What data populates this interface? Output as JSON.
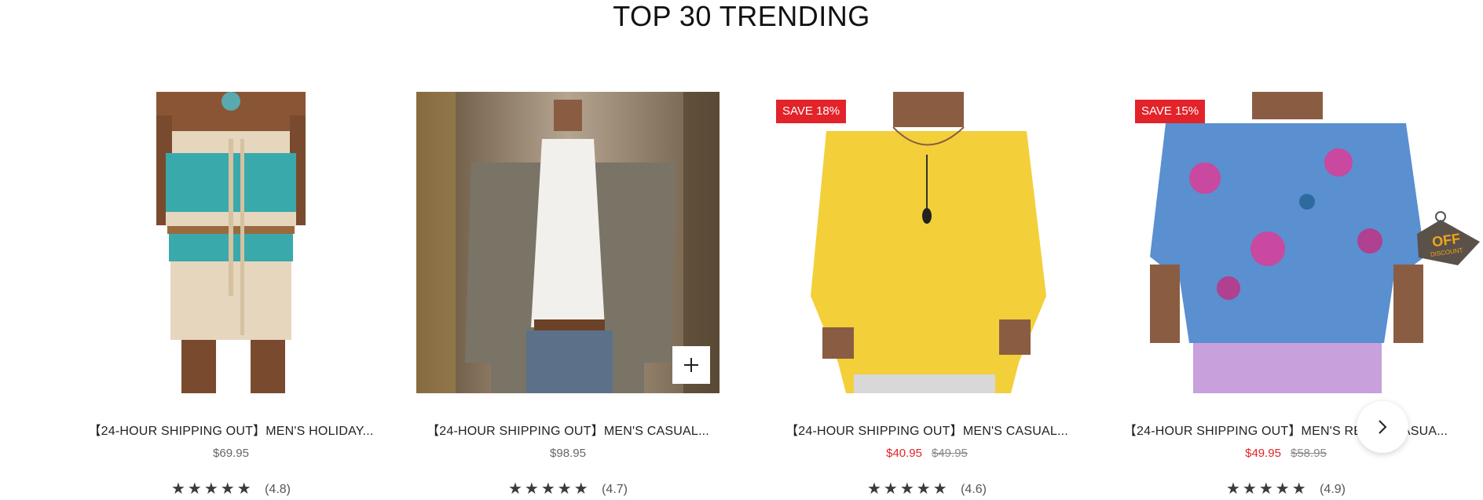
{
  "section": {
    "title": "TOP 30 TRENDING"
  },
  "products": [
    {
      "name": "【24-HOUR SHIPPING OUT】MEN'S HOLIDAY...",
      "price": "$69.95",
      "rating_text": "(4.8)",
      "rating": 4.8,
      "badge": null
    },
    {
      "name": "【24-HOUR SHIPPING OUT】MEN'S CASUAL...",
      "price": "$98.95",
      "rating_text": "(4.7)",
      "rating": 4.7,
      "badge": null,
      "quick_add": true
    },
    {
      "name": "【24-HOUR SHIPPING OUT】MEN'S CASUAL...",
      "price": "$40.95",
      "old_price": "$49.95",
      "rating_text": "(4.6)",
      "rating": 4.6,
      "badge": "SAVE 18%"
    },
    {
      "name": "【24-HOUR SHIPPING OUT】MEN'S RETRO CASUA...",
      "price": "$49.95",
      "old_price": "$58.95",
      "rating_text": "(4.9)",
      "rating": 4.9,
      "badge": "SAVE 15%"
    }
  ],
  "off_tag": {
    "main": "OFF",
    "sub": "DISCOUNT"
  },
  "colors": {
    "sale": "#e2232a",
    "stars": "#3b3b3b",
    "off_tag": "#f2a51a"
  },
  "icons": {
    "quick_add": "plus-icon",
    "carousel_next": "chevron-right-icon",
    "rating": "star-icon",
    "promo": "off-discount-tag-icon"
  }
}
